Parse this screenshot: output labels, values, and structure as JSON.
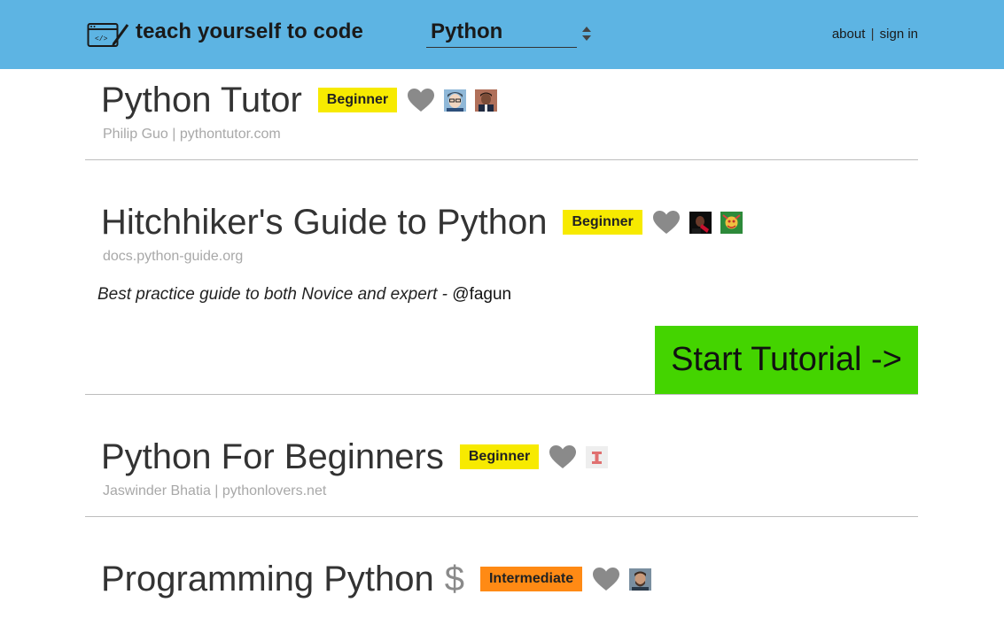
{
  "header": {
    "brand": "teach yourself to code",
    "language": "Python",
    "nav": {
      "about": "about",
      "separator": "|",
      "signin": "sign in"
    },
    "bg_color": "#5db4e3"
  },
  "resources": [
    {
      "title": "Python Tutor",
      "level": "Beginner",
      "subtitle": "Philip Guo | pythontutor.com",
      "avatars": 2
    },
    {
      "title": "Hitchhiker's Guide to Python",
      "level": "Beginner",
      "subtitle": "docs.python-guide.org",
      "comment": "Best practice guide to both Novice and expert - ",
      "comment_author": "@fagun",
      "cta": "Start Tutorial ->",
      "avatars": 2
    },
    {
      "title": "Python For Beginners",
      "level": "Beginner",
      "subtitle": "Jaswinder Bhatia | pythonlovers.net",
      "avatars": 1
    },
    {
      "title": "Programming Python",
      "price_symbol": "$",
      "level": "Intermediate",
      "avatars": 1
    }
  ],
  "colors": {
    "beginner": "#f7ea00",
    "intermediate": "#ff8a14",
    "cta": "#44d400",
    "heart": "#8a8a8a"
  }
}
